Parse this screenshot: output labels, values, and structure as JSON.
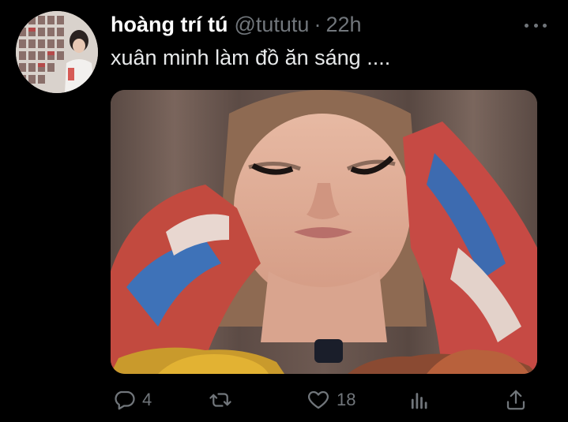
{
  "tweet": {
    "display_name": "hoàng trí tú",
    "handle": "@tututu",
    "separator": "·",
    "time": "22h",
    "text": "xuân minh làm đồ ăn sáng ....",
    "more_icon": "ellipsis-icon"
  },
  "actions": {
    "reply": {
      "icon": "reply-icon",
      "count": "4"
    },
    "retweet": {
      "icon": "retweet-icon",
      "count": ""
    },
    "like": {
      "icon": "heart-icon",
      "count": "18"
    },
    "analytics": {
      "icon": "analytics-icon"
    },
    "share": {
      "icon": "share-icon"
    }
  },
  "colors": {
    "background": "#000000",
    "primary_text": "#e7e9ea",
    "secondary_text": "#71767b"
  }
}
